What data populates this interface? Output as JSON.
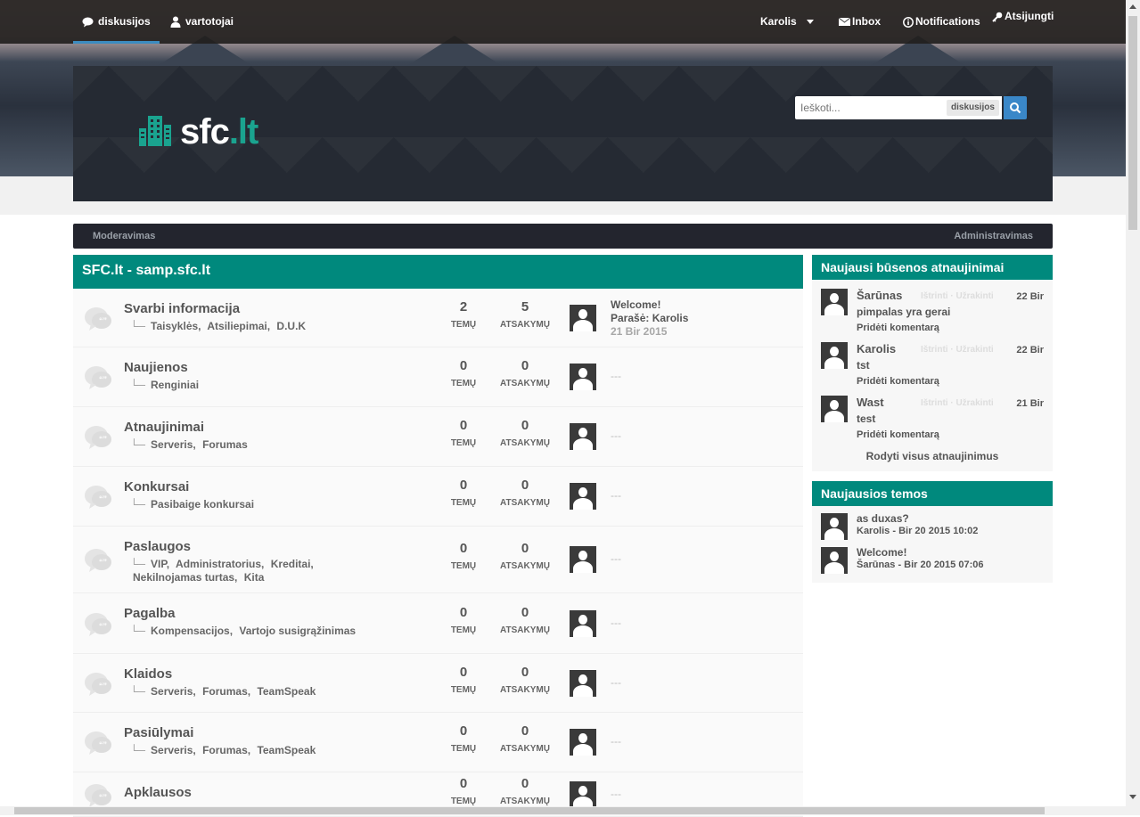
{
  "topnav": {
    "left": [
      {
        "label": "diskusijos",
        "icon": "speech-bubble-icon",
        "active": true
      },
      {
        "label": "vartotojai",
        "icon": "user-icon"
      }
    ],
    "user": "Karolis",
    "inbox": "Inbox",
    "notifications": "Notifications",
    "logout": "Atsijungti"
  },
  "brand": {
    "logo_main": "sfc",
    "logo_accent": ".lt",
    "logo_color": "#1aa38f"
  },
  "search": {
    "placeholder": "Ieškoti...",
    "scope": "diskusijos"
  },
  "subnav": {
    "left": "Moderavimas",
    "right": "Administravimas"
  },
  "forum": {
    "header": "SFC.lt - samp.sfc.lt",
    "stat_topics_label": "TEMŲ",
    "stat_replies_label": "ATSAKYMŲ",
    "rows": [
      {
        "title": "Svarbi informacija",
        "subforums": [
          "Taisyklės,",
          "Atsiliepimai,",
          "D.U.K"
        ],
        "topics": "2",
        "replies": "5",
        "last_title": "Welcome!",
        "last_by": "Parašė: Karolis",
        "last_date": "21 Bir 2015"
      },
      {
        "title": "Naujienos",
        "subforums": [
          "Renginiai"
        ],
        "topics": "0",
        "replies": "0",
        "last_title": "---"
      },
      {
        "title": "Atnaujinimai",
        "subforums": [
          "Serveris,",
          "Forumas"
        ],
        "topics": "0",
        "replies": "0",
        "last_title": "---"
      },
      {
        "title": "Konkursai",
        "subforums": [
          "Pasibaige konkursai"
        ],
        "topics": "0",
        "replies": "0",
        "last_title": "---"
      },
      {
        "title": "Paslaugos",
        "subforums": [
          "VIP,",
          "Administratorius,",
          "Kreditai,",
          "Nekilnojamas turtas,",
          "Kita"
        ],
        "topics": "0",
        "replies": "0",
        "last_title": "---"
      },
      {
        "title": "Pagalba",
        "subforums": [
          "Kompensacijos,",
          "Vartojo susigrąžinimas"
        ],
        "topics": "0",
        "replies": "0",
        "last_title": "---"
      },
      {
        "title": "Klaidos",
        "subforums": [
          "Serveris,",
          "Forumas,",
          "TeamSpeak"
        ],
        "topics": "0",
        "replies": "0",
        "last_title": "---"
      },
      {
        "title": "Pasiūlymai",
        "subforums": [
          "Serveris,",
          "Forumas,",
          "TeamSpeak"
        ],
        "topics": "0",
        "replies": "0",
        "last_title": "---"
      },
      {
        "title": "Apklausos",
        "subforums": [],
        "topics": "0",
        "replies": "0",
        "last_title": "---"
      }
    ]
  },
  "status_updates": {
    "header": "Naujausi būsenos atnaujinimai",
    "actions": "Ištrinti · Užrakinti",
    "comment_label": "Pridėti komentarą",
    "items": [
      {
        "name": "Šarūnas",
        "date": "22 Bir",
        "message": "pimpalas yra gerai"
      },
      {
        "name": "Karolis",
        "date": "22 Bir",
        "message": "tst"
      },
      {
        "name": "Wast",
        "date": "21 Bir",
        "message": "test"
      }
    ],
    "show_all": "Rodyti visus atnaujinimus"
  },
  "latest_topics": {
    "header": "Naujausios temos",
    "items": [
      {
        "title": "as duxas?",
        "meta": "Karolis - Bir 20 2015 10:02"
      },
      {
        "title": "Welcome!",
        "meta": "Šarūnas - Bir 20 2015 07:06"
      }
    ]
  }
}
